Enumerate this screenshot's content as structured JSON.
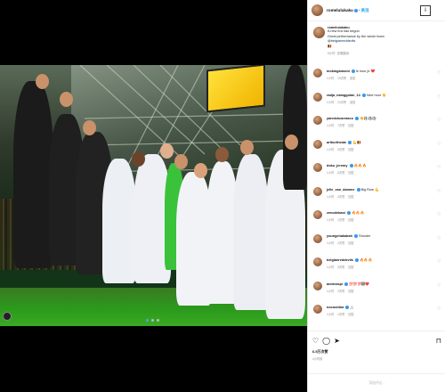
{
  "post": {
    "author": "romelulukaku",
    "follow_label": "关注",
    "more_icon": "more-icon"
  },
  "caption": {
    "username": "romelulukaku",
    "line1": "A new era has begun",
    "line2": "Great performance by the whole team",
    "mention": "@belgianreddevils",
    "flag": "🇧🇪",
    "time": "5小时",
    "translate": "查看翻译"
  },
  "comments": [
    {
      "user": "mokingarasmi",
      "text": "Ik hoor je ❤️",
      "time": "1小时",
      "likes": "19次赞",
      "reply": "回复"
    },
    {
      "user": "radja_nainggolan_14",
      "text": "Nice hoor 👏",
      "time": "1小时",
      "likes": "24次赞",
      "reply": "回复"
    },
    {
      "user": "yannickcarrasco",
      "text": "👏⚽⚽⚽",
      "time": "1小时",
      "likes": "7次赞",
      "reply": "回复"
    },
    {
      "user": "arthurtheate",
      "text": "💪🇧🇪",
      "time": "1小时",
      "likes": "5次赞",
      "reply": "回复"
    },
    {
      "user": "doku_jeremy",
      "text": "🔥🔥🔥",
      "time": "1小时",
      "likes": "6次赞",
      "reply": "回复"
    },
    {
      "user": "jelle_van_damme",
      "text": "Big Rom 💪",
      "time": "1小时",
      "likes": "4次赞",
      "reply": "回复"
    },
    {
      "user": "zenodebast",
      "text": "🔥🔥🔥",
      "time": "1小时",
      "likes": "1次赞",
      "reply": "回复"
    },
    {
      "user": "youngchakabah",
      "text": "Shooter",
      "time": "1小时",
      "likes": "2次赞",
      "reply": "回复"
    },
    {
      "user": "belgianreddevils",
      "text": "🔥🔥🔥",
      "time": "1小时",
      "likes": "3次赞",
      "reply": "回复"
    },
    {
      "user": "andreaspi",
      "text": "💯💯💯🏽❤️",
      "time": "1小时",
      "likes": "2次赞",
      "reply": "回复"
    },
    {
      "user": "nocouldna",
      "text": "🙏🏻",
      "time": "1小时",
      "likes": "1次赞",
      "reply": "回复"
    }
  ],
  "actions": {
    "likes": "6.5万次赞",
    "date": "4小时前"
  },
  "add_comment": {
    "placeholder": "添加评论..."
  },
  "colors": {
    "accent": "#0095f6",
    "verified": "#3897f0",
    "board": "#ffe23a"
  }
}
